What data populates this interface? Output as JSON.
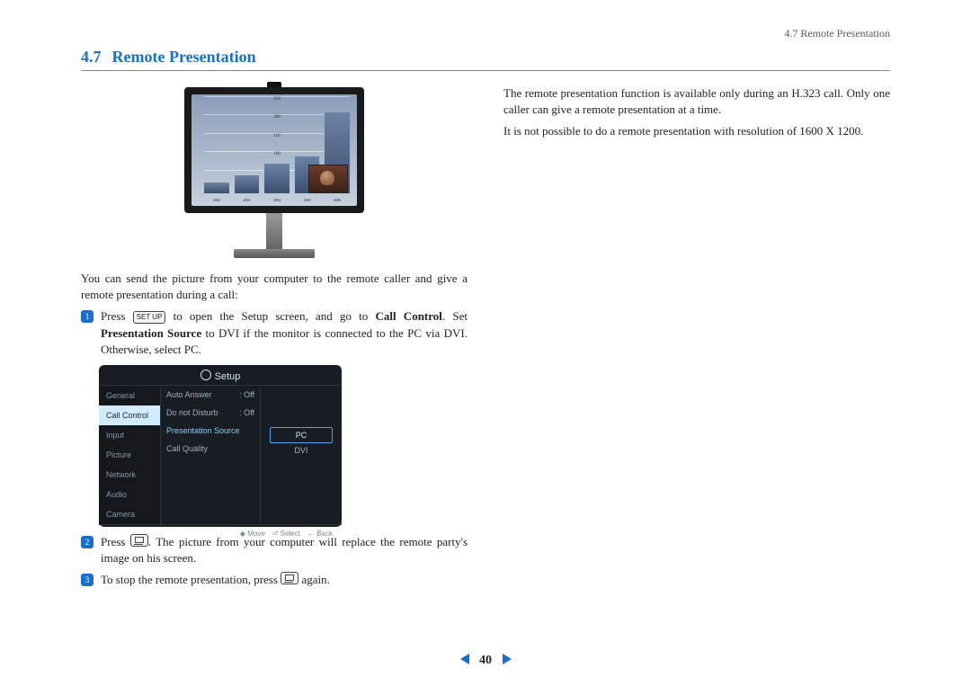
{
  "header": {
    "right": "4.7 Remote Presentation"
  },
  "section": {
    "num": "4.7",
    "title": "Remote Presentation"
  },
  "left": {
    "intro": "You can send the picture from your computer to the remote caller and give a remote presentation during a call:",
    "step1_a": "Press ",
    "step1_key": "SET UP",
    "step1_b": " to open the Setup screen, and go to ",
    "step1_bold1": "Call Control",
    "step1_c": ". Set ",
    "step1_bold2": "Presentation Source",
    "step1_d": " to DVI if the monitor is connected to the PC via DVI. Otherwise, select PC.",
    "step2_a": "Press ",
    "step2_b": ". The picture from your computer will replace the remote party's image on his screen.",
    "step3_a": "To stop the remote presentation, press ",
    "step3_b": " again."
  },
  "right": {
    "p1": "The remote presentation function is available only during an H.323 call. Only one caller can give a remote presentation at a time.",
    "p2": "It is not possible to do a remote presentation with resolution of 1600 X 1200."
  },
  "osd": {
    "title": "Setup",
    "left": [
      "General",
      "Call Control",
      "Input",
      "Picture",
      "Network",
      "Audio",
      "Camera"
    ],
    "left_selected_index": 1,
    "mid": [
      {
        "label": "Auto Answer",
        "value": ": Off"
      },
      {
        "label": "Do not Disturb",
        "value": ": Off"
      },
      {
        "label": "Presentation Source",
        "value": ""
      },
      {
        "label": "Call Quality",
        "value": ""
      }
    ],
    "mid_selected_index": 2,
    "right_opts": [
      "PC",
      "DVI"
    ],
    "right_selected_index": 0,
    "foot": [
      "◆ Move",
      "⏎ Select",
      "← Back"
    ]
  },
  "chart_data": {
    "type": "bar",
    "categories": [
      "2002",
      "2003",
      "2004",
      "2005",
      "2006"
    ],
    "values": [
      30,
      50,
      80,
      100,
      220
    ],
    "ylim": [
      0,
      250
    ],
    "yticks": [
      50,
      100,
      150,
      200,
      250
    ]
  },
  "pager": {
    "num": "40"
  }
}
